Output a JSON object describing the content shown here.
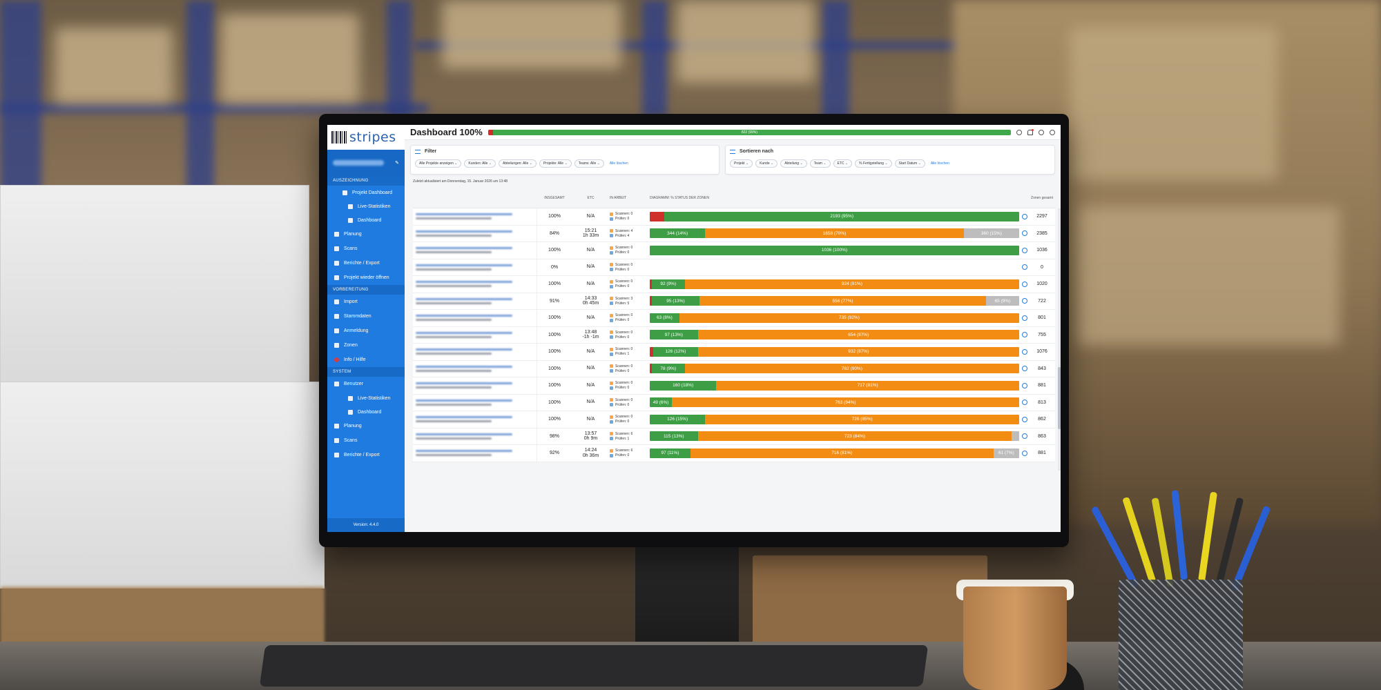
{
  "app": {
    "logo": "stripes",
    "title": "Dashboard 100%",
    "overall_progress": {
      "label": "822 (99%)",
      "fraction_done": 0.99,
      "fraction_red": 0.01
    },
    "version": "Version: 4.4.0"
  },
  "sidebar": {
    "sections": [
      {
        "title": "AUSZEICHNUNG",
        "items": [
          {
            "label": "Projekt Dashboard",
            "level": 1,
            "icon": "grid-icon"
          },
          {
            "label": "Live-Statistiken",
            "level": 2,
            "icon": "chart-icon"
          },
          {
            "label": "Dashboard",
            "level": 2,
            "icon": "dashboard-icon"
          },
          {
            "label": "Planung",
            "level": 0,
            "icon": "calendar-icon"
          },
          {
            "label": "Scans",
            "level": 0,
            "icon": "barcode-icon"
          },
          {
            "label": "Berichte / Export",
            "level": 0,
            "icon": "report-icon"
          },
          {
            "label": "Projekt wieder öffnen",
            "level": 0,
            "icon": "play-icon"
          }
        ]
      },
      {
        "title": "VORBEREITUNG",
        "items": [
          {
            "label": "Import",
            "level": 0,
            "icon": "import-icon"
          },
          {
            "label": "Stammdaten",
            "level": 0,
            "icon": "database-icon"
          },
          {
            "label": "Anmeldung",
            "level": 0,
            "icon": "user-icon"
          },
          {
            "label": "Zonen",
            "level": 0,
            "icon": "zones-icon"
          },
          {
            "label": "Info / Hilfe",
            "level": 0,
            "icon": "help-icon"
          }
        ]
      },
      {
        "title": "SYSTEM",
        "items": [
          {
            "label": "Benutzer",
            "level": 0,
            "icon": "users-icon"
          },
          {
            "label": "Live-Statistiken",
            "level": 2,
            "icon": "chart-icon"
          },
          {
            "label": "Dashboard",
            "level": 2,
            "icon": "dashboard-icon"
          },
          {
            "label": "Planung",
            "level": 0,
            "icon": "calendar-icon"
          },
          {
            "label": "Scans",
            "level": 0,
            "icon": "barcode-icon"
          },
          {
            "label": "Berichte / Export",
            "level": 0,
            "icon": "report-icon"
          }
        ]
      }
    ]
  },
  "filter": {
    "title": "Filter",
    "chips": [
      "Alle Projekte anzeigen",
      "Kunden: Alle",
      "Abteilungen: Alle",
      "Projekte: Alle",
      "Teams: Alle"
    ],
    "clear_label": "Alle löschen"
  },
  "sort": {
    "title": "Sortieren nach",
    "chips": [
      "Projekt",
      "Kunde",
      "Abteilung",
      "Team",
      "ETC",
      "% Fertigstellung",
      "Start Datum"
    ],
    "clear_label": "Alle löschen"
  },
  "updated_text": "Zuletzt aktualisiert am Donnerstag, 15. Januar 2026 um 13:48",
  "table": {
    "headers": {
      "pct": "INSGESAMT",
      "etc": "ETC",
      "work": "In Arbeit",
      "diagram": "DIAGRAMM: % Status der Zonen",
      "zones": "Zonen gesamt"
    },
    "work_labels": {
      "scan": "Scannen",
      "check": "Prüfen"
    },
    "rows": [
      {
        "pct": "100%",
        "etc": "N/A",
        "etc2": "",
        "scan": "0",
        "check": "0",
        "zones": "2297",
        "segments": [
          {
            "c": "red",
            "v": 0.04,
            "t": ""
          },
          {
            "c": "green",
            "v": 0.96,
            "t": "2193 (95%)"
          }
        ]
      },
      {
        "pct": "84%",
        "etc": "15:21",
        "etc2": "1h 33m",
        "scan": "4",
        "check": "4",
        "zones": "2385",
        "segments": [
          {
            "c": "green",
            "v": 0.15,
            "t": "344 (14%)"
          },
          {
            "c": "orange",
            "v": 0.7,
            "t": "1658 (70%)"
          },
          {
            "c": "grey",
            "v": 0.15,
            "t": "360 (15%)"
          }
        ]
      },
      {
        "pct": "100%",
        "etc": "N/A",
        "etc2": "",
        "scan": "0",
        "check": "0",
        "zones": "1036",
        "segments": [
          {
            "c": "green",
            "v": 1.0,
            "t": "1036 (100%)"
          }
        ]
      },
      {
        "pct": "0%",
        "etc": "N/A",
        "etc2": "",
        "scan": "0",
        "check": "0",
        "zones": "0",
        "segments": []
      },
      {
        "pct": "100%",
        "etc": "N/A",
        "etc2": "",
        "scan": "0",
        "check": "0",
        "zones": "1020",
        "segments": [
          {
            "c": "red",
            "v": 0.005,
            "t": ""
          },
          {
            "c": "green",
            "v": 0.09,
            "t": "92 (9%)"
          },
          {
            "c": "orange",
            "v": 0.905,
            "t": "924 (91%)"
          }
        ]
      },
      {
        "pct": "91%",
        "etc": "14:33",
        "etc2": "0h 45m",
        "scan": "3",
        "check": "5",
        "zones": "722",
        "segments": [
          {
            "c": "red",
            "v": 0.005,
            "t": ""
          },
          {
            "c": "green",
            "v": 0.13,
            "t": "95 (13%)"
          },
          {
            "c": "orange",
            "v": 0.775,
            "t": "556 (77%)"
          },
          {
            "c": "grey",
            "v": 0.09,
            "t": "65 (9%)"
          }
        ]
      },
      {
        "pct": "100%",
        "etc": "N/A",
        "etc2": "",
        "scan": "0",
        "check": "0",
        "zones": "801",
        "segments": [
          {
            "c": "green",
            "v": 0.08,
            "t": "63 (8%)"
          },
          {
            "c": "orange",
            "v": 0.92,
            "t": "735 (92%)"
          }
        ]
      },
      {
        "pct": "100%",
        "etc": "13:48",
        "etc2": "-1h -1m",
        "scan": "0",
        "check": "0",
        "zones": "755",
        "segments": [
          {
            "c": "green",
            "v": 0.13,
            "t": "97 (13%)"
          },
          {
            "c": "orange",
            "v": 0.87,
            "t": "654 (87%)"
          }
        ]
      },
      {
        "pct": "100%",
        "etc": "N/A",
        "etc2": "",
        "scan": "0",
        "check": "1",
        "zones": "1076",
        "segments": [
          {
            "c": "red",
            "v": 0.01,
            "t": ""
          },
          {
            "c": "green",
            "v": 0.12,
            "t": "126 (12%)"
          },
          {
            "c": "orange",
            "v": 0.87,
            "t": "932 (87%)"
          }
        ]
      },
      {
        "pct": "100%",
        "etc": "N/A",
        "etc2": "",
        "scan": "0",
        "check": "0",
        "zones": "843",
        "segments": [
          {
            "c": "red",
            "v": 0.005,
            "t": ""
          },
          {
            "c": "green",
            "v": 0.09,
            "t": "78 (9%)"
          },
          {
            "c": "orange",
            "v": 0.905,
            "t": "762 (90%)"
          }
        ]
      },
      {
        "pct": "100%",
        "etc": "N/A",
        "etc2": "",
        "scan": "0",
        "check": "0",
        "zones": "881",
        "segments": [
          {
            "c": "green",
            "v": 0.18,
            "t": "160 (18%)"
          },
          {
            "c": "orange",
            "v": 0.82,
            "t": "717 (81%)"
          }
        ]
      },
      {
        "pct": "100%",
        "etc": "N/A",
        "etc2": "",
        "scan": "0",
        "check": "0",
        "zones": "813",
        "segments": [
          {
            "c": "green",
            "v": 0.06,
            "t": "49 (6%)"
          },
          {
            "c": "orange",
            "v": 0.94,
            "t": "763 (94%)"
          }
        ]
      },
      {
        "pct": "100%",
        "etc": "N/A",
        "etc2": "",
        "scan": "0",
        "check": "0",
        "zones": "862",
        "segments": [
          {
            "c": "green",
            "v": 0.15,
            "t": "126 (15%)"
          },
          {
            "c": "orange",
            "v": 0.85,
            "t": "726 (85%)"
          }
        ]
      },
      {
        "pct": "98%",
        "etc": "13:57",
        "etc2": "0h 9m",
        "scan": "6",
        "check": "1",
        "zones": "863",
        "segments": [
          {
            "c": "green",
            "v": 0.13,
            "t": "115 (13%)"
          },
          {
            "c": "orange",
            "v": 0.85,
            "t": "723 (84%)"
          },
          {
            "c": "grey",
            "v": 0.02,
            "t": ""
          }
        ]
      },
      {
        "pct": "92%",
        "etc": "14:24",
        "etc2": "0h 36m",
        "scan": "6",
        "check": "0",
        "zones": "881",
        "segments": [
          {
            "c": "green",
            "v": 0.11,
            "t": "97 (11%)"
          },
          {
            "c": "orange",
            "v": 0.82,
            "t": "716 (81%)"
          },
          {
            "c": "grey",
            "v": 0.07,
            "t": "61 (7%)"
          }
        ]
      }
    ]
  },
  "colors": {
    "sidebar": "#1f7be0",
    "done": "#3d9e45",
    "in_progress": "#f28c12",
    "open": "#bdbdbd",
    "error": "#d0302a"
  }
}
